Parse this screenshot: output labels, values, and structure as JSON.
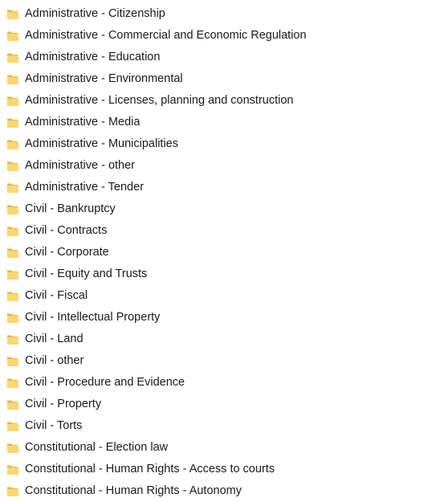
{
  "folders": [
    {
      "label": "Administrative - Citizenship"
    },
    {
      "label": "Administrative - Commercial and Economic Regulation"
    },
    {
      "label": "Administrative - Education"
    },
    {
      "label": "Administrative - Environmental"
    },
    {
      "label": "Administrative - Licenses, planning and construction"
    },
    {
      "label": "Administrative - Media"
    },
    {
      "label": "Administrative - Municipalities"
    },
    {
      "label": "Administrative - other"
    },
    {
      "label": "Administrative - Tender"
    },
    {
      "label": "Civil - Bankruptcy"
    },
    {
      "label": "Civil - Contracts"
    },
    {
      "label": "Civil - Corporate"
    },
    {
      "label": "Civil - Equity and Trusts"
    },
    {
      "label": "Civil - Fiscal"
    },
    {
      "label": "Civil - Intellectual Property"
    },
    {
      "label": "Civil - Land"
    },
    {
      "label": "Civil - other"
    },
    {
      "label": "Civil - Procedure and Evidence"
    },
    {
      "label": "Civil - Property"
    },
    {
      "label": "Civil - Torts"
    },
    {
      "label": "Constitutional - Election law"
    },
    {
      "label": "Constitutional - Human Rights - Access to courts"
    },
    {
      "label": "Constitutional - Human Rights - Autonomy"
    }
  ],
  "icon": "folder-icon",
  "colors": {
    "folder_front": "#f8d775",
    "folder_back": "#e6b847",
    "text": "#1a1a1a"
  }
}
